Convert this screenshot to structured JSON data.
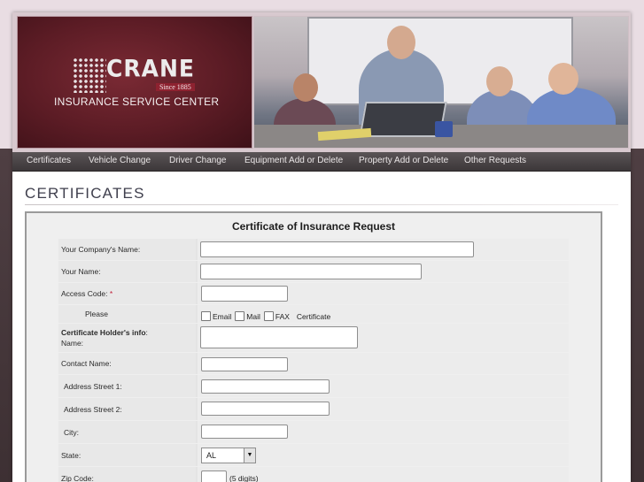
{
  "brand": {
    "name": "CRANE",
    "since": "Since 1885",
    "tagline": "INSURANCE SERVICE CENTER"
  },
  "nav": {
    "items": [
      {
        "label": "Certificates"
      },
      {
        "label": "Vehicle Change"
      },
      {
        "label": "Driver Change"
      },
      {
        "label": "Equipment Add or Delete"
      },
      {
        "label": "Property Add or Delete"
      },
      {
        "label": "Other Requests"
      }
    ]
  },
  "page": {
    "title": "CERTIFICATES"
  },
  "form": {
    "title": "Certificate of Insurance Request",
    "company_label": "Your Company's Name:",
    "company_value": "",
    "your_name_label": "Your Name:",
    "your_name_value": "",
    "access_code_label": "Access Code:",
    "access_code_required": "*",
    "access_code_value": "",
    "please_label": "Please",
    "delivery_options": [
      {
        "label": "Email",
        "checked": false
      },
      {
        "label": "Mail",
        "checked": false
      },
      {
        "label": "FAX",
        "checked": false
      }
    ],
    "delivery_suffix": "Certificate",
    "holder_label_bold": "Certificate Holder's info",
    "holder_label_colon": ":",
    "holder_label_name": "Name:",
    "holder_value": "",
    "contact_label": "Contact Name:",
    "contact_value": "",
    "street1_label": "Address Street 1:",
    "street1_value": "",
    "street2_label": "Address Street 2:",
    "street2_value": "",
    "city_label": "City:",
    "city_value": "",
    "state_label": "State:",
    "state_value": "AL",
    "zip_label": "Zip Code:",
    "zip_value": "",
    "zip_hint": "(5 digits)"
  },
  "colors": {
    "brand_red": "#5c1c25",
    "nav_bg": "#3c3739",
    "required": "#c0203a"
  },
  "icons": {
    "select_arrow": "triangle-down"
  }
}
